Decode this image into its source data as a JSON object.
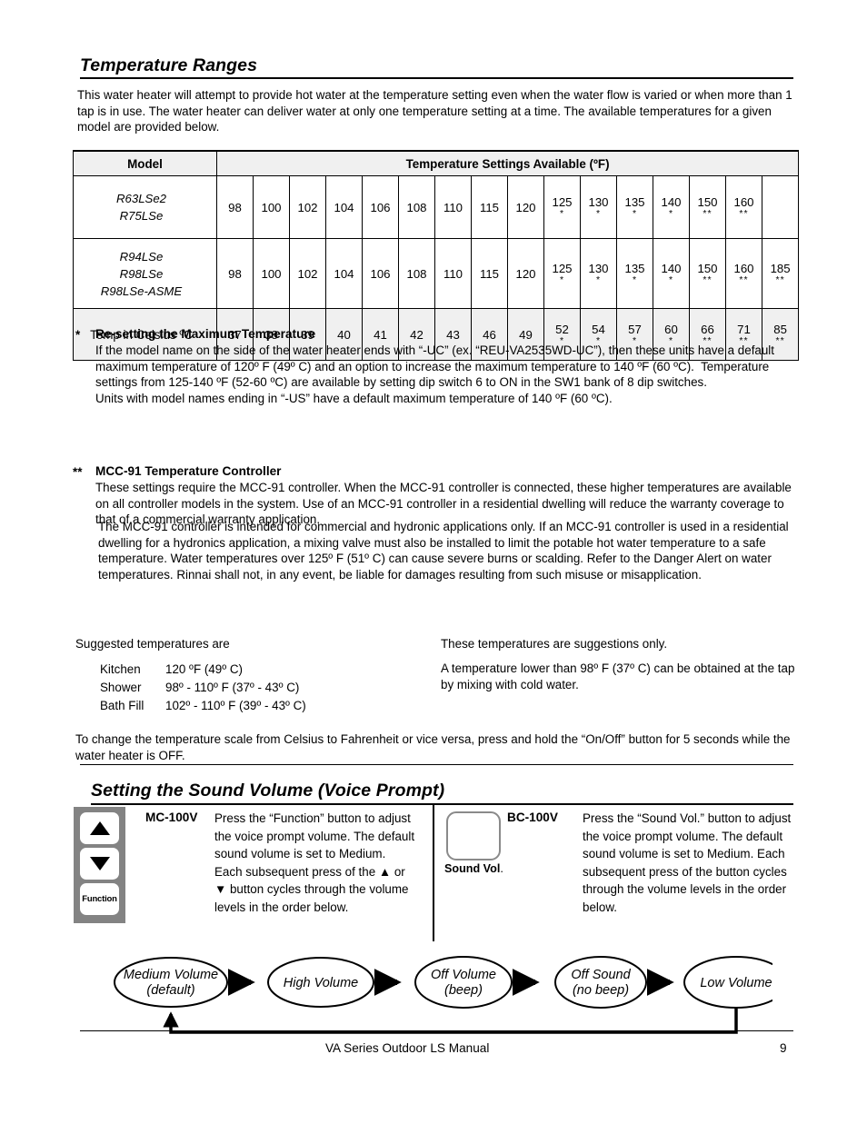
{
  "document": {
    "footer_title": "VA Series Outdoor LS Manual",
    "page_number": "9"
  },
  "temperature_ranges": {
    "heading": "Temperature Ranges",
    "intro": "This water heater will attempt to provide hot water at the temperature setting even when the water flow is varied or when more than 1 tap is in use.  The water heater can deliver water at only one temperature setting at a time. The available temperatures for a given model are provided below.",
    "table": {
      "header_model": "Model",
      "header_settings": "Temperature Settings Available (ºF)",
      "rows": [
        {
          "model": "R63LSe2\nR75LSe",
          "model_line1": "R63LSe2",
          "model_line2": "R75LSe",
          "model_line3": "",
          "values": [
            {
              "num": "98",
              "mark": ""
            },
            {
              "num": "100",
              "mark": ""
            },
            {
              "num": "102",
              "mark": ""
            },
            {
              "num": "104",
              "mark": ""
            },
            {
              "num": "106",
              "mark": ""
            },
            {
              "num": "108",
              "mark": ""
            },
            {
              "num": "110",
              "mark": ""
            },
            {
              "num": "115",
              "mark": ""
            },
            {
              "num": "120",
              "mark": ""
            },
            {
              "num": "125",
              "mark": "*"
            },
            {
              "num": "130",
              "mark": "*"
            },
            {
              "num": "135",
              "mark": "*"
            },
            {
              "num": "140",
              "mark": "*"
            },
            {
              "num": "150",
              "mark": "**"
            },
            {
              "num": "160",
              "mark": "**"
            },
            {
              "num": "",
              "mark": ""
            }
          ]
        },
        {
          "model_line1": "R94LSe",
          "model_line2": "R98LSe",
          "model_line3": "R98LSe-ASME",
          "values": [
            {
              "num": "98",
              "mark": ""
            },
            {
              "num": "100",
              "mark": ""
            },
            {
              "num": "102",
              "mark": ""
            },
            {
              "num": "104",
              "mark": ""
            },
            {
              "num": "106",
              "mark": ""
            },
            {
              "num": "108",
              "mark": ""
            },
            {
              "num": "110",
              "mark": ""
            },
            {
              "num": "115",
              "mark": ""
            },
            {
              "num": "120",
              "mark": ""
            },
            {
              "num": "125",
              "mark": "*"
            },
            {
              "num": "130",
              "mark": "*"
            },
            {
              "num": "135",
              "mark": "*"
            },
            {
              "num": "140",
              "mark": "*"
            },
            {
              "num": "150",
              "mark": "**"
            },
            {
              "num": "160",
              "mark": "**"
            },
            {
              "num": "185",
              "mark": "**"
            }
          ]
        },
        {
          "model_line1": "Temp in Celsius  ºC",
          "model_line2": "",
          "model_line3": "",
          "values": [
            {
              "num": "37",
              "mark": ""
            },
            {
              "num": "38",
              "mark": ""
            },
            {
              "num": "39",
              "mark": ""
            },
            {
              "num": "40",
              "mark": ""
            },
            {
              "num": "41",
              "mark": ""
            },
            {
              "num": "42",
              "mark": ""
            },
            {
              "num": "43",
              "mark": ""
            },
            {
              "num": "46",
              "mark": ""
            },
            {
              "num": "49",
              "mark": ""
            },
            {
              "num": "52",
              "mark": "*"
            },
            {
              "num": "54",
              "mark": "*"
            },
            {
              "num": "57",
              "mark": "*"
            },
            {
              "num": "60",
              "mark": "*"
            },
            {
              "num": "66",
              "mark": "**"
            },
            {
              "num": "71",
              "mark": "**"
            },
            {
              "num": "85",
              "mark": "**"
            }
          ]
        }
      ]
    }
  },
  "footnotes": {
    "one": {
      "marker": "*",
      "title": "Re-setting the Maximum Temperature",
      "body": "If the model name on the side of the water heater ends with “-UC” (ex. “REU-VA2535WD-UC”), then these units have a default maximum temperature of 120º F (49º C) and an option to increase the maximum temperature to 140 ºF (60 ºC).  Temperature settings from 125-140 ºF (52-60 ºC) are available by setting dip switch 6 to ON in the SW1 bank of 8 dip switches.\nUnits with model names ending in “-US” have a default maximum temperature of 140 ºF (60 ºC)."
    },
    "two": {
      "marker": "**",
      "title": "MCC-91 Temperature Controller",
      "body": "These settings require the MCC-91 controller.  When the MCC-91 controller is connected, these higher temperatures are available on all controller models in the system. Use of an MCC-91 controller in a residential dwelling will reduce the warranty coverage to that of a commercial warranty application.",
      "body2": "The MCC-91 controller is intended for commercial and hydronic applications only. If an MCC-91 controller is used in a residential dwelling for a hydronics application, a mixing valve must also be installed to limit the potable hot water temperature to a safe temperature. Water temperatures over 125º F (51º C) can cause severe burns or scalding. Refer to the Danger Alert on water temperatures. Rinnai shall not, in any event, be liable for damages resulting from such misuse or misapplication."
    }
  },
  "suggested": {
    "heading": "Suggested temperatures are",
    "items": [
      {
        "label": "Kitchen",
        "value": "120 ºF (49º C)"
      },
      {
        "label": "Shower",
        "value": "98º - 110º F (37º - 43º C)"
      },
      {
        "label": "Bath Fill",
        "value": "102º - 110º F (39º - 43º C)"
      }
    ],
    "note1": "These temperatures are suggestions only.",
    "note2": "A temperature lower than 98º F (37º C) can be obtained at the tap by mixing with cold water.",
    "change_scale": "To change the temperature scale from Celsius to Fahrenheit or vice versa, press and hold the “On/Off” button for 5 seconds while the water heater is OFF."
  },
  "sound_volume": {
    "heading": "Setting the Sound Volume (Voice Prompt)",
    "mc": {
      "model": "MC-100V",
      "text": "Press the “Function” button to adjust the voice prompt volume.  The default sound volume is set to Medium.  Each subsequent press of the ▲ or ▼ button cycles through the volume levels in the order below.",
      "button_function_label": "Function"
    },
    "bc": {
      "model": "BC-100V",
      "text": "Press the “Sound Vol.” button to adjust the voice prompt volume. The default sound volume is set to Medium.  Each subsequent press of the button cycles through the volume levels in the order below.",
      "button_label": "Sound Vol",
      "button_label_suffix": "."
    },
    "flow": {
      "nodes": [
        {
          "line1": "Medium Volume",
          "line2": "(default)"
        },
        {
          "line1": "High Volume",
          "line2": ""
        },
        {
          "line1": "Off Volume",
          "line2": "(beep)"
        },
        {
          "line1": "Off Sound",
          "line2": "(no beep)"
        },
        {
          "line1": "Low Volume",
          "line2": ""
        }
      ]
    }
  }
}
